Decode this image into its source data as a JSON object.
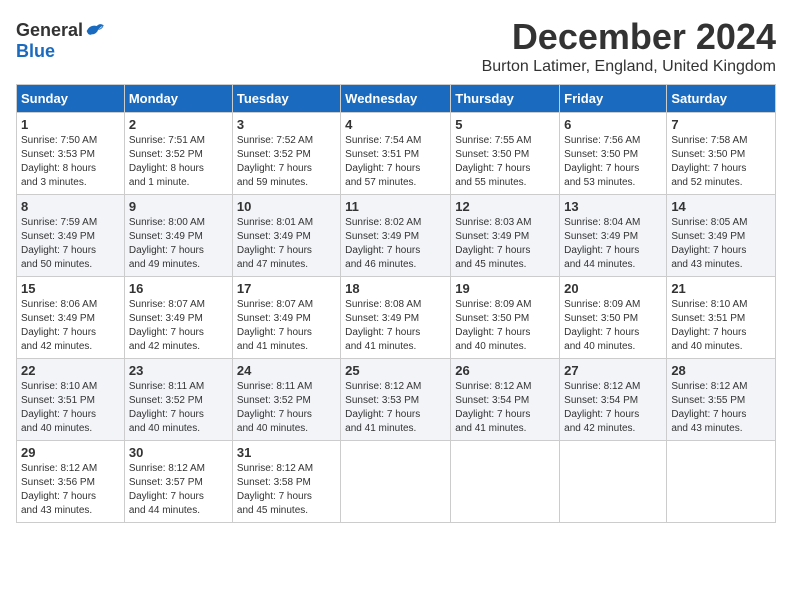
{
  "logo": {
    "general": "General",
    "blue": "Blue"
  },
  "title": "December 2024",
  "subtitle": "Burton Latimer, England, United Kingdom",
  "days_header": [
    "Sunday",
    "Monday",
    "Tuesday",
    "Wednesday",
    "Thursday",
    "Friday",
    "Saturday"
  ],
  "weeks": [
    [
      {
        "num": "1",
        "info": "Sunrise: 7:50 AM\nSunset: 3:53 PM\nDaylight: 8 hours\nand 3 minutes."
      },
      {
        "num": "2",
        "info": "Sunrise: 7:51 AM\nSunset: 3:52 PM\nDaylight: 8 hours\nand 1 minute."
      },
      {
        "num": "3",
        "info": "Sunrise: 7:52 AM\nSunset: 3:52 PM\nDaylight: 7 hours\nand 59 minutes."
      },
      {
        "num": "4",
        "info": "Sunrise: 7:54 AM\nSunset: 3:51 PM\nDaylight: 7 hours\nand 57 minutes."
      },
      {
        "num": "5",
        "info": "Sunrise: 7:55 AM\nSunset: 3:50 PM\nDaylight: 7 hours\nand 55 minutes."
      },
      {
        "num": "6",
        "info": "Sunrise: 7:56 AM\nSunset: 3:50 PM\nDaylight: 7 hours\nand 53 minutes."
      },
      {
        "num": "7",
        "info": "Sunrise: 7:58 AM\nSunset: 3:50 PM\nDaylight: 7 hours\nand 52 minutes."
      }
    ],
    [
      {
        "num": "8",
        "info": "Sunrise: 7:59 AM\nSunset: 3:49 PM\nDaylight: 7 hours\nand 50 minutes."
      },
      {
        "num": "9",
        "info": "Sunrise: 8:00 AM\nSunset: 3:49 PM\nDaylight: 7 hours\nand 49 minutes."
      },
      {
        "num": "10",
        "info": "Sunrise: 8:01 AM\nSunset: 3:49 PM\nDaylight: 7 hours\nand 47 minutes."
      },
      {
        "num": "11",
        "info": "Sunrise: 8:02 AM\nSunset: 3:49 PM\nDaylight: 7 hours\nand 46 minutes."
      },
      {
        "num": "12",
        "info": "Sunrise: 8:03 AM\nSunset: 3:49 PM\nDaylight: 7 hours\nand 45 minutes."
      },
      {
        "num": "13",
        "info": "Sunrise: 8:04 AM\nSunset: 3:49 PM\nDaylight: 7 hours\nand 44 minutes."
      },
      {
        "num": "14",
        "info": "Sunrise: 8:05 AM\nSunset: 3:49 PM\nDaylight: 7 hours\nand 43 minutes."
      }
    ],
    [
      {
        "num": "15",
        "info": "Sunrise: 8:06 AM\nSunset: 3:49 PM\nDaylight: 7 hours\nand 42 minutes."
      },
      {
        "num": "16",
        "info": "Sunrise: 8:07 AM\nSunset: 3:49 PM\nDaylight: 7 hours\nand 42 minutes."
      },
      {
        "num": "17",
        "info": "Sunrise: 8:07 AM\nSunset: 3:49 PM\nDaylight: 7 hours\nand 41 minutes."
      },
      {
        "num": "18",
        "info": "Sunrise: 8:08 AM\nSunset: 3:49 PM\nDaylight: 7 hours\nand 41 minutes."
      },
      {
        "num": "19",
        "info": "Sunrise: 8:09 AM\nSunset: 3:50 PM\nDaylight: 7 hours\nand 40 minutes."
      },
      {
        "num": "20",
        "info": "Sunrise: 8:09 AM\nSunset: 3:50 PM\nDaylight: 7 hours\nand 40 minutes."
      },
      {
        "num": "21",
        "info": "Sunrise: 8:10 AM\nSunset: 3:51 PM\nDaylight: 7 hours\nand 40 minutes."
      }
    ],
    [
      {
        "num": "22",
        "info": "Sunrise: 8:10 AM\nSunset: 3:51 PM\nDaylight: 7 hours\nand 40 minutes."
      },
      {
        "num": "23",
        "info": "Sunrise: 8:11 AM\nSunset: 3:52 PM\nDaylight: 7 hours\nand 40 minutes."
      },
      {
        "num": "24",
        "info": "Sunrise: 8:11 AM\nSunset: 3:52 PM\nDaylight: 7 hours\nand 40 minutes."
      },
      {
        "num": "25",
        "info": "Sunrise: 8:12 AM\nSunset: 3:53 PM\nDaylight: 7 hours\nand 41 minutes."
      },
      {
        "num": "26",
        "info": "Sunrise: 8:12 AM\nSunset: 3:54 PM\nDaylight: 7 hours\nand 41 minutes."
      },
      {
        "num": "27",
        "info": "Sunrise: 8:12 AM\nSunset: 3:54 PM\nDaylight: 7 hours\nand 42 minutes."
      },
      {
        "num": "28",
        "info": "Sunrise: 8:12 AM\nSunset: 3:55 PM\nDaylight: 7 hours\nand 43 minutes."
      }
    ],
    [
      {
        "num": "29",
        "info": "Sunrise: 8:12 AM\nSunset: 3:56 PM\nDaylight: 7 hours\nand 43 minutes."
      },
      {
        "num": "30",
        "info": "Sunrise: 8:12 AM\nSunset: 3:57 PM\nDaylight: 7 hours\nand 44 minutes."
      },
      {
        "num": "31",
        "info": "Sunrise: 8:12 AM\nSunset: 3:58 PM\nDaylight: 7 hours\nand 45 minutes."
      },
      null,
      null,
      null,
      null
    ]
  ]
}
